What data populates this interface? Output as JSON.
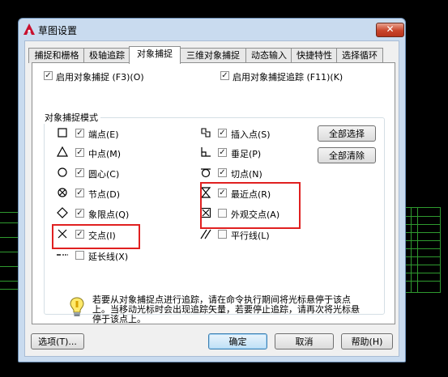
{
  "window": {
    "title": "草图设置",
    "close_label": "✕"
  },
  "tabs": [
    "捕捉和栅格",
    "极轴追踪",
    "对象捕捉",
    "三维对象捕捉",
    "动态输入",
    "快捷特性",
    "选择循环"
  ],
  "active_tab": "对象捕捉",
  "top_options": {
    "enable_snap": "启用对象捕捉 (F3)(O)",
    "enable_snap_checked": true,
    "enable_tracking": "启用对象捕捉追踪 (F11)(K)",
    "enable_tracking_checked": true
  },
  "group_title": "对象捕捉模式",
  "modes_left": [
    {
      "icon": "square-snap-icon",
      "label": "端点(E)",
      "checked": true
    },
    {
      "icon": "triangle-snap-icon",
      "label": "中点(M)",
      "checked": true
    },
    {
      "icon": "circle-snap-icon",
      "label": "圆心(C)",
      "checked": true
    },
    {
      "icon": "node-snap-icon",
      "label": "节点(D)",
      "checked": true
    },
    {
      "icon": "diamond-snap-icon",
      "label": "象限点(Q)",
      "checked": true
    },
    {
      "icon": "cross-snap-icon",
      "label": "交点(I)",
      "checked": true
    },
    {
      "icon": "extension-snap-icon",
      "label": "延长线(X)",
      "checked": false
    }
  ],
  "modes_right": [
    {
      "icon": "insertion-snap-icon",
      "label": "插入点(S)",
      "checked": true
    },
    {
      "icon": "perpendicular-snap-icon",
      "label": "垂足(P)",
      "checked": true
    },
    {
      "icon": "tangent-snap-icon",
      "label": "切点(N)",
      "checked": true
    },
    {
      "icon": "nearest-snap-icon",
      "label": "最近点(R)",
      "checked": true
    },
    {
      "icon": "apparent-intersection-snap-icon",
      "label": "外观交点(A)",
      "checked": false
    },
    {
      "icon": "parallel-snap-icon",
      "label": "平行线(L)",
      "checked": false
    }
  ],
  "side_buttons": {
    "select_all": "全部选择",
    "clear_all": "全部清除"
  },
  "tip_text": "若要从对象捕捉点进行追踪，请在命令执行期间将光标悬停于该点上。当移动光标时会出现追踪矢量，若要停止追踪，请再次将光标悬停于该点上。",
  "footer": {
    "options": "选项(T)...",
    "ok": "确定",
    "cancel": "取消",
    "help": "帮助(H)"
  },
  "colors": {
    "highlight_box": "#e02020",
    "cad_lines": "#2f9a2f",
    "title_bar": "#c9dbef"
  }
}
